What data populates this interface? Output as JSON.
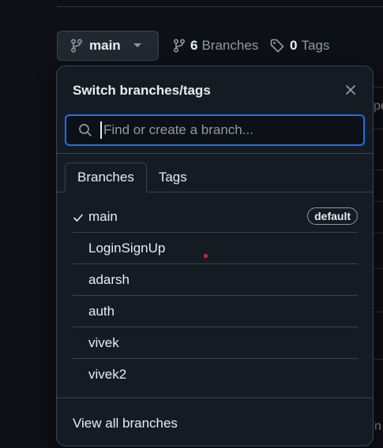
{
  "toolbar": {
    "branch_button_label": "main",
    "branches_count": "6",
    "branches_label": "Branches",
    "tags_count": "0",
    "tags_label": "Tags"
  },
  "dropdown": {
    "title": "Switch branches/tags",
    "search_placeholder": "Find or create a branch...",
    "tabs": [
      {
        "label": "Branches",
        "active": true
      },
      {
        "label": "Tags",
        "active": false
      }
    ],
    "branches": [
      {
        "name": "main",
        "checked": true,
        "badge": "default"
      },
      {
        "name": "LoginSignUp",
        "checked": false,
        "badge": ""
      },
      {
        "name": "adarsh",
        "checked": false,
        "badge": ""
      },
      {
        "name": "auth",
        "checked": false,
        "badge": ""
      },
      {
        "name": "vivek",
        "checked": false,
        "badge": ""
      },
      {
        "name": "vivek2",
        "checked": false,
        "badge": ""
      }
    ],
    "view_all_label": "View all branches"
  },
  "background": {
    "partial_text_right": "pe",
    "partial_text_bottom": "n"
  },
  "colors": {
    "page_bg": "#0d1117",
    "overlay_bg": "#151b23",
    "border": "#3d444d",
    "focus_blue": "#1f6feb",
    "text": "#e6edf3",
    "muted": "#9198a1",
    "cursor_dot": "#e5202c"
  },
  "icons": {
    "branch": "git-branch-icon",
    "caret": "triangle-down-icon",
    "tag": "tag-icon",
    "close": "x-icon",
    "search": "search-icon",
    "check": "check-icon"
  }
}
